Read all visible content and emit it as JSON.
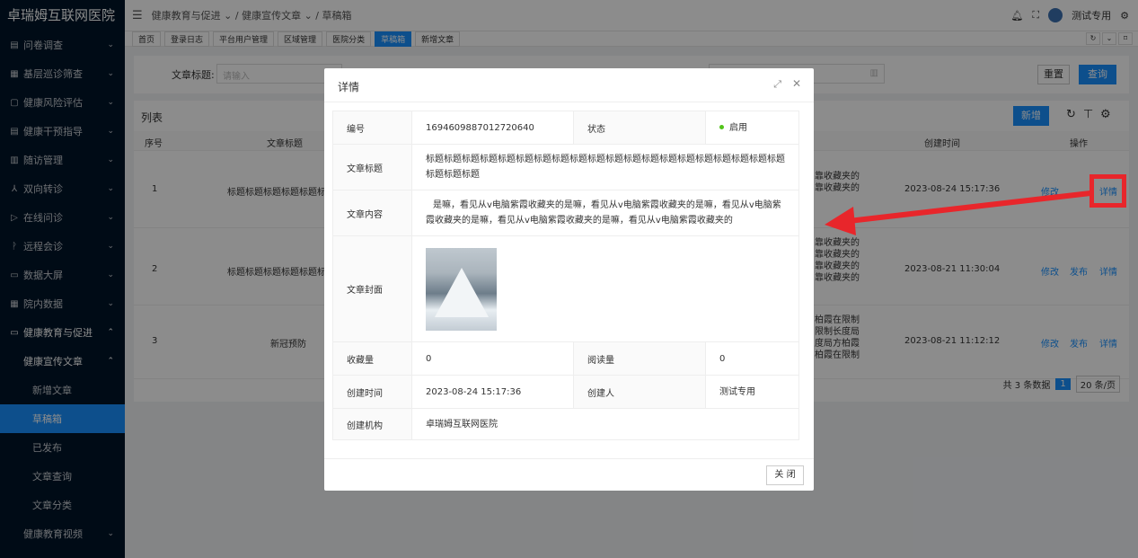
{
  "app": {
    "title": "卓瑞姆互联网医院"
  },
  "sidebar": {
    "items": [
      {
        "label": "问卷调查"
      },
      {
        "label": "基层巡诊筛查"
      },
      {
        "label": "健康风险评估"
      },
      {
        "label": "健康干预指导"
      },
      {
        "label": "随访管理"
      },
      {
        "label": "双向转诊"
      },
      {
        "label": "在线问诊"
      },
      {
        "label": "远程会诊"
      },
      {
        "label": "数据大屏"
      },
      {
        "label": "院内数据"
      },
      {
        "label": "健康教育与促进"
      }
    ],
    "sub_group": "健康宣传文章",
    "sub_items": [
      {
        "label": "新增文章"
      },
      {
        "label": "草稿箱"
      },
      {
        "label": "已发布"
      },
      {
        "label": "文章查询"
      },
      {
        "label": "文章分类"
      }
    ],
    "last_item": "健康教育视频"
  },
  "header": {
    "breadcrumb": [
      "健康教育与促进",
      "健康宣传文章",
      "草稿箱"
    ],
    "user": "测试专用"
  },
  "tags": [
    "首页",
    "登录日志",
    "平台用户管理",
    "区域管理",
    "医院分类",
    "草稿箱",
    "新增文章"
  ],
  "search": {
    "label": "文章标题:",
    "placeholder": "请输入",
    "date_placeholder": "期",
    "reset": "重置",
    "query": "查询"
  },
  "table": {
    "title": "列表",
    "add": "新增",
    "columns": [
      "序号",
      "文章标题",
      "创建时间",
      "操作"
    ],
    "rows": [
      {
        "no": "1",
        "title": "标题标题标题标题标题标",
        "snippet": [
          "靠收藏夹的",
          "靠收藏夹的"
        ],
        "created": "2023-08-24 15:17:36",
        "actions": [
          "修改",
          "详情"
        ]
      },
      {
        "no": "2",
        "title": "标题标题标题标题标题标",
        "snippet": [
          "靠收藏夹的",
          "靠收藏夹的",
          "靠收藏夹的",
          "靠收藏夹的"
        ],
        "created": "2023-08-21 11:30:04",
        "actions": [
          "修改",
          "发布",
          "详情"
        ]
      },
      {
        "no": "3",
        "title": "新冠预防",
        "snippet": [
          "柏霞在限制",
          "限制长度局",
          "度局方柏霞",
          "柏霞在限制"
        ],
        "created": "2023-08-21 11:12:12",
        "actions": [
          "修改",
          "发布",
          "详情"
        ]
      }
    ],
    "pagination": {
      "total": "共 3 条数据",
      "page": "1",
      "size": "20 条/页"
    }
  },
  "modal": {
    "title": "详情",
    "fields": {
      "id_label": "编号",
      "id": "1694609887012720640",
      "status_label": "状态",
      "status": "启用",
      "title_label": "文章标题",
      "title": "标题标题标题标题标题标题标题标题标题标题标题标题标题标题标题标题标题标题标题标题标题标题标题",
      "content_label": "文章内容",
      "content": "是嘛，看见从v电脑紫霞收藏夹的是嘛，看见从v电脑紫霞收藏夹的是嘛，看见从v电脑紫霞收藏夹的是嘛，看见从v电脑紫霞收藏夹的是嘛，看见从v电脑紫霞收藏夹的",
      "cover_label": "文章封面",
      "collect_label": "收藏量",
      "collect": "0",
      "read_label": "阅读量",
      "read": "0",
      "created_label": "创建时间",
      "created": "2023-08-24 15:17:36",
      "creator_label": "创建人",
      "creator": "测试专用",
      "org_label": "创建机构",
      "org": "卓瑞姆互联网医院"
    },
    "close": "关 闭"
  },
  "colors": {
    "accent": "#1890ff",
    "sidebar": "#001529",
    "annotation": "#e8262b"
  }
}
